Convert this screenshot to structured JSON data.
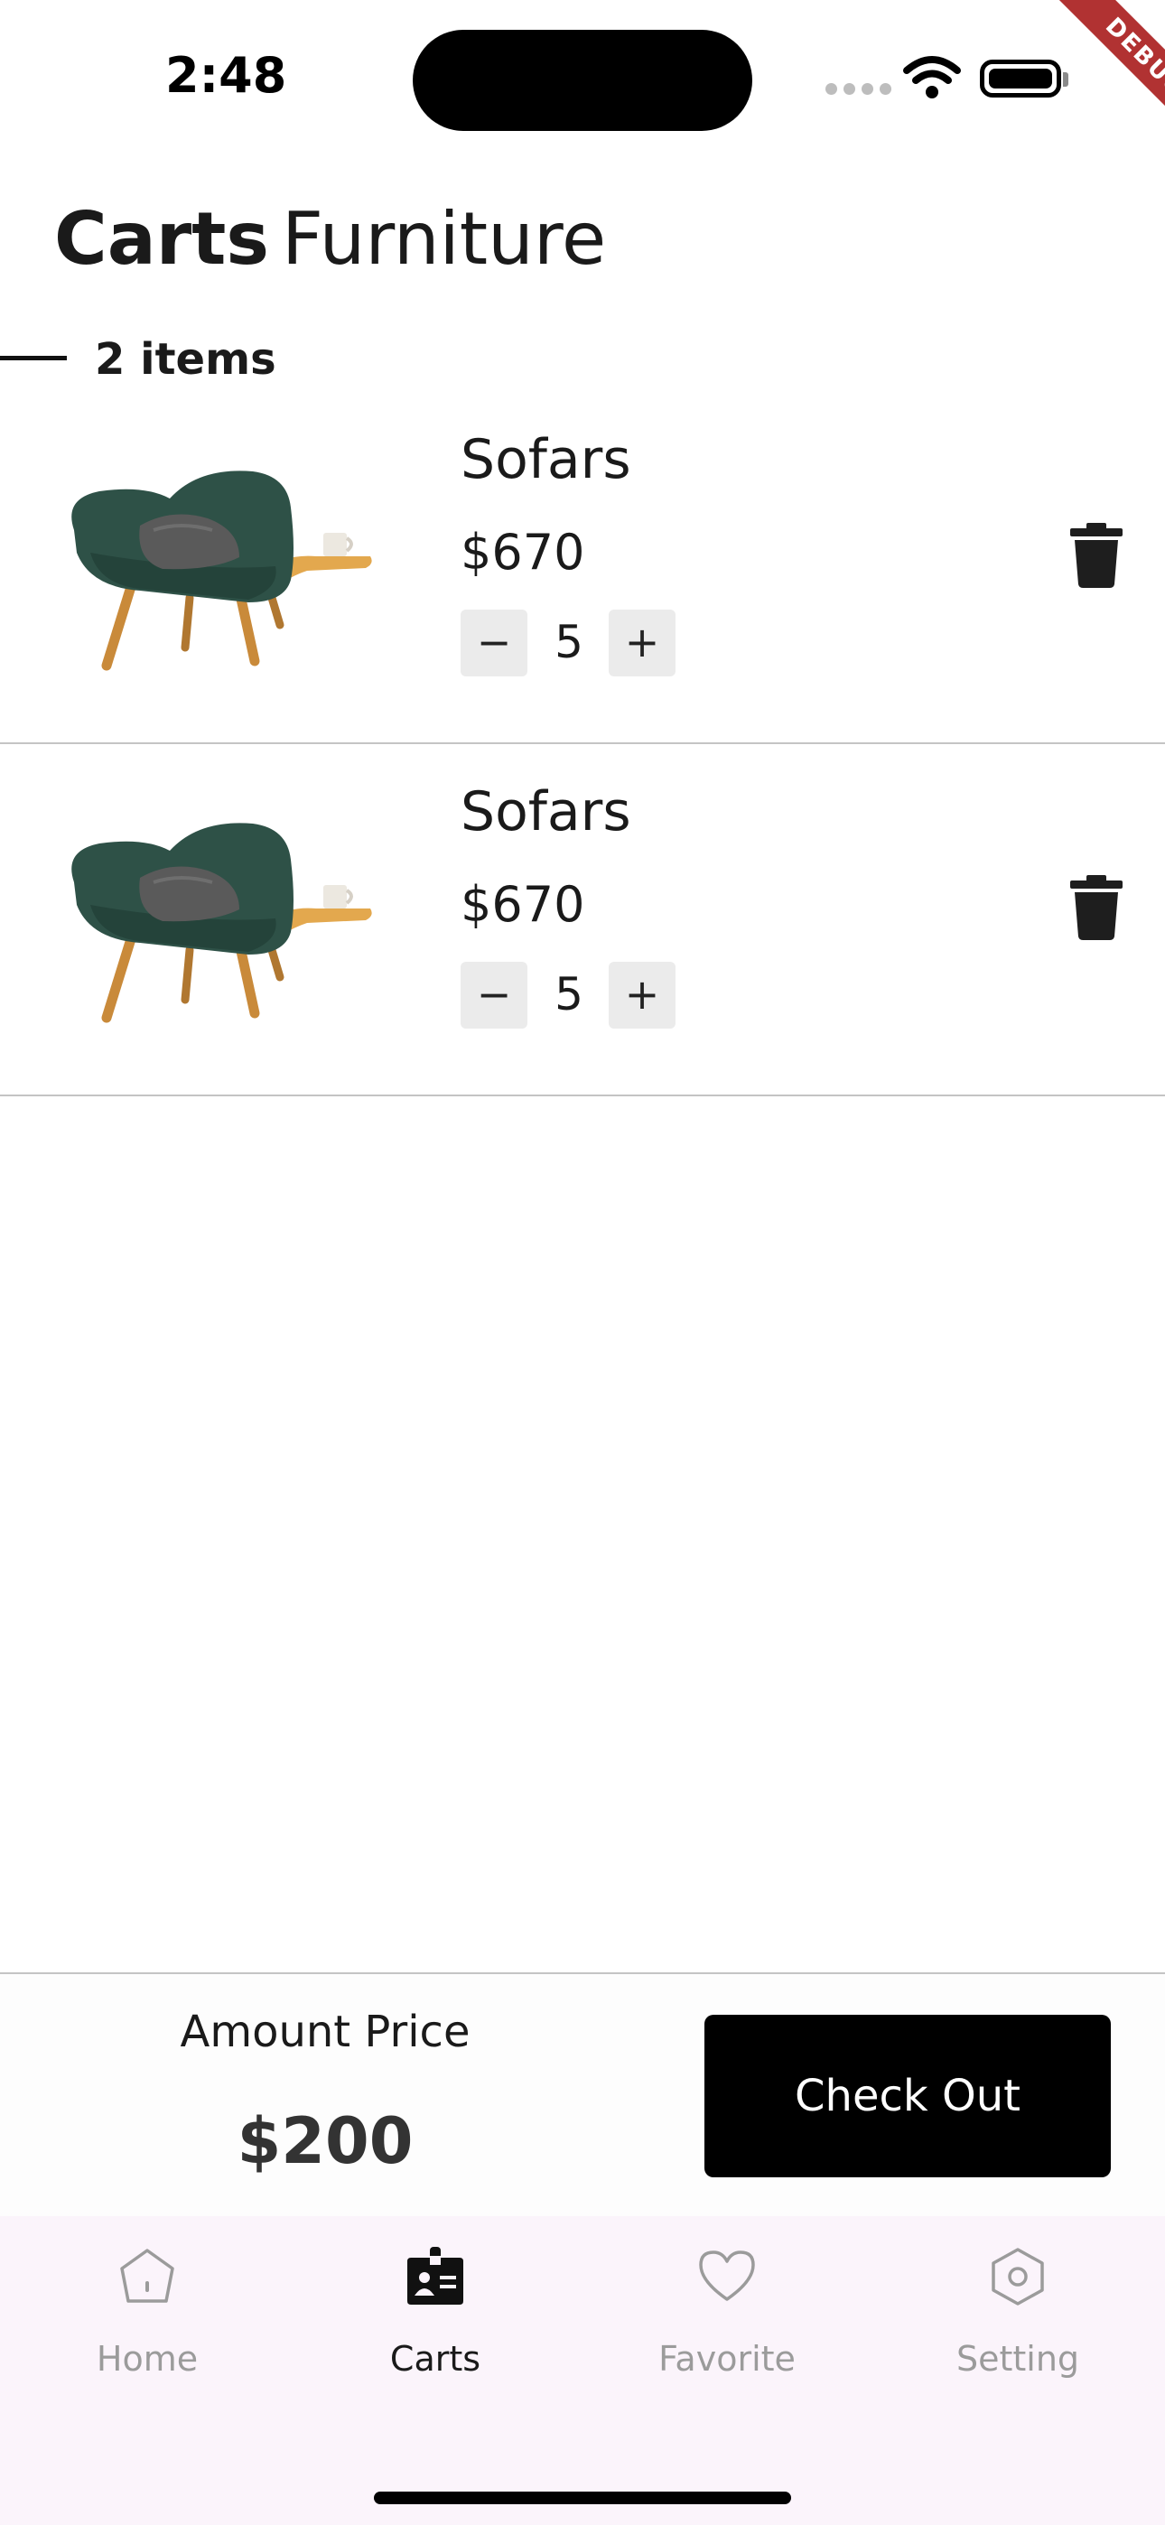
{
  "status_bar": {
    "time": "2:48",
    "debug_label": "DEBUG"
  },
  "header": {
    "title_bold": "Carts",
    "title_light": "Furniture",
    "item_count": "2 items"
  },
  "cart": {
    "items": [
      {
        "name": "Sofars",
        "price": "$670",
        "quantity": "5",
        "minus": "−",
        "plus": "+"
      },
      {
        "name": "Sofars",
        "price": "$670",
        "quantity": "5",
        "minus": "−",
        "plus": "+"
      }
    ]
  },
  "footer": {
    "amount_label": "Amount Price",
    "amount_value": "$200",
    "checkout_label": "Check Out"
  },
  "tabs": [
    {
      "label": "Home",
      "icon": "home-icon",
      "active": false
    },
    {
      "label": "Carts",
      "icon": "badge-icon",
      "active": true
    },
    {
      "label": "Favorite",
      "icon": "heart-icon",
      "active": false
    },
    {
      "label": "Setting",
      "icon": "settings-icon",
      "active": false
    }
  ],
  "colors": {
    "accent": "#000000",
    "tabbar_bg": "#fbf4fb",
    "chair": "#2e5147",
    "debug": "#b13232"
  }
}
